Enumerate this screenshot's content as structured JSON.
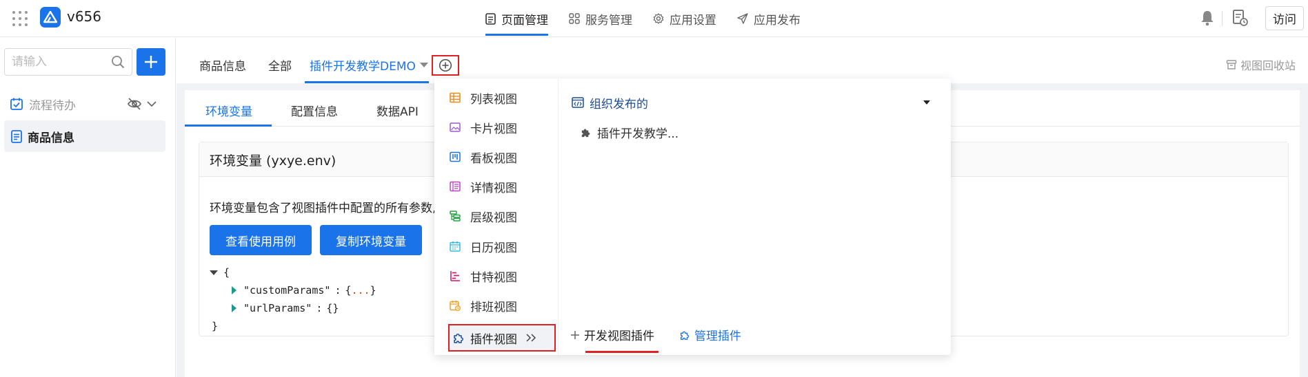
{
  "app": {
    "title": "v656"
  },
  "topnav": [
    {
      "label": "页面管理",
      "icon": "page-icon",
      "active": true
    },
    {
      "label": "服务管理",
      "icon": "grid-services-icon",
      "active": false
    },
    {
      "label": "应用设置",
      "icon": "gear-icon",
      "active": false
    },
    {
      "label": "应用发布",
      "icon": "send-icon",
      "active": false
    }
  ],
  "topright": {
    "visit_label": "访问"
  },
  "sidebar": {
    "search_placeholder": "请输入",
    "items": [
      {
        "label": "流程待办"
      },
      {
        "label": "商品信息",
        "selected": true
      }
    ]
  },
  "view_tabs": {
    "items": [
      {
        "label": "商品信息"
      },
      {
        "label": "全部"
      },
      {
        "label": "插件开发教学DEMO",
        "active": true
      }
    ],
    "recycle_label": "视图回收站"
  },
  "sub_tabs": [
    {
      "label": "环境变量",
      "active": true
    },
    {
      "label": "配置信息"
    },
    {
      "label": "数据API"
    }
  ],
  "env": {
    "title": "环境变量 (yxye.env)",
    "description": "环境变量包含了视图插件中配置的所有参数,",
    "btn_examples": "查看使用用例",
    "btn_copy": "复制环境变量",
    "json_open": "{",
    "json_close": "}",
    "key_custom": "\"customParams\"",
    "val_custom_open": "{",
    "val_custom_ellipsis": "...",
    "val_custom_close": "}",
    "key_url": "\"urlParams\"",
    "val_url": "{}",
    "colon": ":"
  },
  "dropdown": {
    "view_types": [
      {
        "label": "列表视图",
        "icon": "table-icon",
        "color": "#f08c1e"
      },
      {
        "label": "卡片视图",
        "icon": "image-card-icon",
        "color": "#9b59d6"
      },
      {
        "label": "看板视图",
        "icon": "kanban-icon",
        "color": "#1a73e8"
      },
      {
        "label": "详情视图",
        "icon": "detail-icon",
        "color": "#c040c8"
      },
      {
        "label": "层级视图",
        "icon": "hierarchy-icon",
        "color": "#23a045"
      },
      {
        "label": "日历视图",
        "icon": "calendar-icon",
        "color": "#35b8e0"
      },
      {
        "label": "甘特视图",
        "icon": "gantt-icon",
        "color": "#d0206a"
      },
      {
        "label": "排班视图",
        "icon": "schedule-icon",
        "color": "#f0a020"
      }
    ],
    "plugin_view_label": "插件视图",
    "org_label": "组织发布的",
    "plugin_item": "插件开发教学...",
    "dev_plugin_label": "开发视图插件",
    "manage_plugin_label": "管理插件"
  }
}
